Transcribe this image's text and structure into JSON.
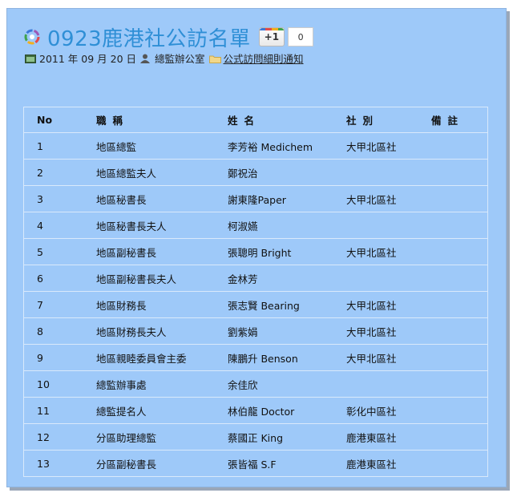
{
  "page": {
    "title": "0923鹿港社公訪名單",
    "gplus_label": "+1",
    "gplus_count": "0",
    "meta": {
      "date": "2011 年 09 月 20 日",
      "author": "總監辦公室",
      "category": "公式訪問細則通知"
    },
    "colors": {
      "panel": "#9ec9f9",
      "title": "#2f8fd6",
      "grid": "#d9e9fb"
    },
    "icons": {
      "logo": "colorful-rotary-logo-icon",
      "date": "calendar-icon",
      "author": "user-icon",
      "category": "folder-icon"
    }
  },
  "table": {
    "headers": [
      "No",
      "職稱",
      "姓名",
      "社別",
      "備註"
    ],
    "rows": [
      [
        "1",
        "地區總監",
        "李芳裕 Medichem",
        "大甲北區社",
        ""
      ],
      [
        "2",
        "地區總監夫人",
        "鄭祝治",
        "",
        ""
      ],
      [
        "3",
        "地區秘書長",
        "謝東隆Paper",
        "大甲北區社",
        ""
      ],
      [
        "4",
        "地區秘書長夫人",
        "柯淑嬿",
        "",
        ""
      ],
      [
        "5",
        "地區副秘書長",
        "張聰明 Bright",
        "大甲北區社",
        ""
      ],
      [
        "6",
        "地區副秘書長夫人",
        "金林芳",
        "",
        ""
      ],
      [
        "7",
        "地區財務長",
        "張志賢 Bearing",
        "大甲北區社",
        ""
      ],
      [
        "8",
        "地區財務長夫人",
        "劉紫娟",
        "大甲北區社",
        ""
      ],
      [
        "9",
        "地區親睦委員會主委",
        "陳鵬升 Benson",
        "大甲北區社",
        ""
      ],
      [
        "10",
        "總監辦事處",
        "余佳欣",
        "",
        ""
      ],
      [
        "11",
        "總監提名人",
        "林伯龍 Doctor",
        "彰化中區社",
        ""
      ],
      [
        "12",
        "分區助理總監",
        "蔡國正 King",
        "鹿港東區社",
        ""
      ],
      [
        "13",
        "分區副秘書長",
        "張皆福 S.F",
        "鹿港東區社",
        ""
      ]
    ]
  }
}
